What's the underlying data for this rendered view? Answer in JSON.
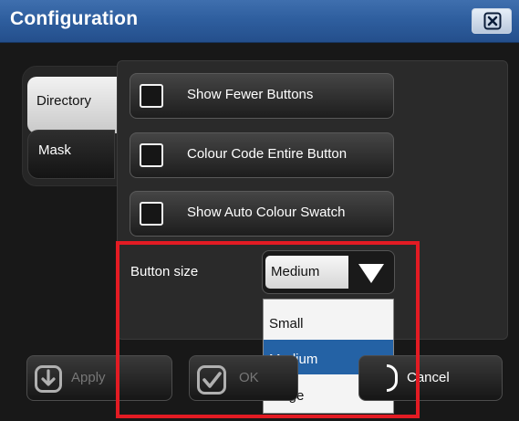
{
  "window": {
    "title": "Configuration"
  },
  "tabs": [
    {
      "label": "Directory",
      "selected": true
    },
    {
      "label": "Mask",
      "selected": false
    }
  ],
  "options": [
    {
      "label": "Show Fewer Buttons",
      "checked": false
    },
    {
      "label": "Colour Code Entire Button",
      "checked": false
    },
    {
      "label": "Show Auto Colour Swatch",
      "checked": false
    }
  ],
  "button_size": {
    "label": "Button size",
    "selected": "Medium",
    "options": [
      "Small",
      "Medium",
      "Large"
    ],
    "highlighted": "Medium"
  },
  "footer": {
    "apply_label": "Apply",
    "ok_label": "OK",
    "cancel_label": "Cancel"
  },
  "colors": {
    "titlebar": "#2f5f9f",
    "highlight_frame": "#e31b23",
    "selected_item": "#2462a5"
  },
  "icons": {
    "close": "close-x-icon",
    "apply": "download-arrow-icon",
    "ok": "checkmark-icon",
    "cancel": "cancel-icon",
    "dropdown": "chevron-down-icon"
  }
}
